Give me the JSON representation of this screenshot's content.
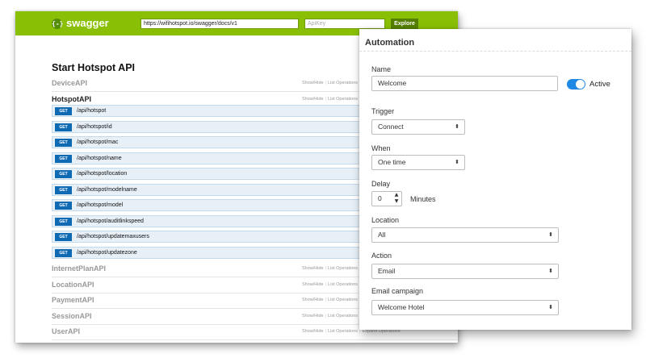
{
  "swagger": {
    "logo": "swagger",
    "logo_icon": "{-}",
    "url": "https://wifihotspot.io/swagger/docs/v1",
    "api_key_placeholder": "ApiKey",
    "explore_label": "Explore",
    "page_title": "Start Hotspot API",
    "show_hide": "Show/Hide",
    "list_operations": "List Operations",
    "expand_operations": "Expand Operations",
    "groups_top": [
      {
        "name": "DeviceAPI"
      },
      {
        "name": "HotspotAPI"
      }
    ],
    "operations": [
      {
        "verb": "GET",
        "path": "/api/hotspot"
      },
      {
        "verb": "GET",
        "path": "/api/hotspot/id"
      },
      {
        "verb": "GET",
        "path": "/api/hotspot/mac"
      },
      {
        "verb": "GET",
        "path": "/api/hotspot/name"
      },
      {
        "verb": "GET",
        "path": "/api/hotspot/location"
      },
      {
        "verb": "GET",
        "path": "/api/hotspot/modelname"
      },
      {
        "verb": "GET",
        "path": "/api/hotspot/model"
      },
      {
        "verb": "GET",
        "path": "/api/hotspot/auditlinkspeed"
      },
      {
        "verb": "GET",
        "path": "/api/hotspot/updatemaxusers"
      },
      {
        "verb": "GET",
        "path": "/api/hotspot/updatezone"
      }
    ],
    "groups_bottom": [
      {
        "name": "InternetPlanAPI"
      },
      {
        "name": "LocationAPI"
      },
      {
        "name": "PaymentAPI"
      },
      {
        "name": "SessionAPI"
      },
      {
        "name": "UserAPI"
      }
    ]
  },
  "automation": {
    "title": "Automation",
    "name_label": "Name",
    "name_value": "Welcome",
    "active_label": "Active",
    "active": true,
    "trigger_label": "Trigger",
    "trigger_value": "Connect",
    "when_label": "When",
    "when_value": "One time",
    "delay_label": "Delay",
    "delay_value": "0",
    "delay_unit": "Minutes",
    "location_label": "Location",
    "location_value": "All",
    "action_label": "Action",
    "action_value": "Email",
    "campaign_label": "Email campaign",
    "campaign_value": "Welcome Hotel"
  },
  "colors": {
    "swagger_header": "#89bf04",
    "get_verb": "#0f6ab4",
    "toggle_on": "#1e88e5"
  }
}
